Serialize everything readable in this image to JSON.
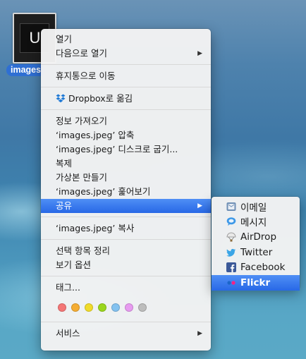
{
  "file": {
    "name": "images",
    "thumb_text": "U"
  },
  "menu": {
    "groups": [
      [
        {
          "label": "열기",
          "submenu": false
        },
        {
          "label": "다음으로 열기",
          "submenu": true
        }
      ],
      [
        {
          "label": "휴지통으로 이동",
          "submenu": false
        }
      ],
      [
        {
          "label": "Dropbox로 옮김",
          "submenu": false,
          "icon": "dropbox-icon"
        }
      ],
      [
        {
          "label": "정보 가져오기",
          "submenu": false
        },
        {
          "label": "‘images.jpeg’ 압축",
          "submenu": false
        },
        {
          "label": "‘images.jpeg’ 디스크로 굽기...",
          "submenu": false
        },
        {
          "label": "복제",
          "submenu": false
        },
        {
          "label": "가상본 만들기",
          "submenu": false
        },
        {
          "label": "‘images.jpeg’ 훑어보기",
          "submenu": false
        },
        {
          "label": "공유",
          "submenu": true,
          "highlighted": true
        }
      ],
      [
        {
          "label": "‘images.jpeg’ 복사",
          "submenu": false
        }
      ],
      [
        {
          "label": "선택 항목 정리",
          "submenu": false
        },
        {
          "label": "보기 옵션",
          "submenu": false
        }
      ]
    ],
    "tags_label": "태그...",
    "tag_colors": [
      "#f47676",
      "#f5ad33",
      "#f0db2a",
      "#9ad61d",
      "#83c2f0",
      "#e79bf0",
      "#bdbdbd"
    ],
    "services_label": "서비스"
  },
  "share_submenu": [
    {
      "label": "이메일",
      "icon": "mail-icon"
    },
    {
      "label": "메시지",
      "icon": "messages-icon"
    },
    {
      "label": "AirDrop",
      "icon": "airdrop-icon"
    },
    {
      "label": "Twitter",
      "icon": "twitter-icon"
    },
    {
      "label": "Facebook",
      "icon": "facebook-icon"
    },
    {
      "label": "Flickr",
      "icon": "flickr-icon",
      "highlighted": true
    }
  ],
  "colors": {
    "highlight": "#2f6fe8",
    "label_selection": "#2f6fd3"
  }
}
